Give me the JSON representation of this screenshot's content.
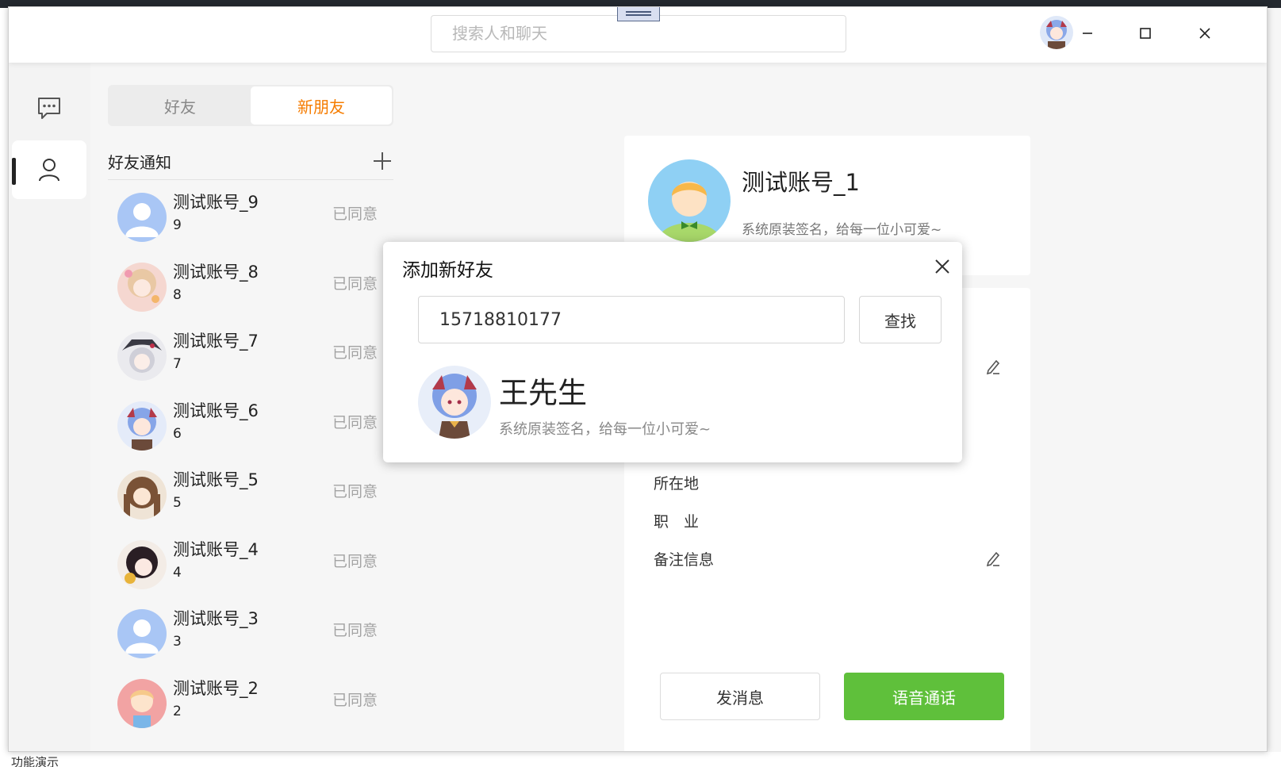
{
  "background": {
    "bottom_text": "功能演示"
  },
  "search": {
    "placeholder": "搜索人和聊天"
  },
  "nav": {
    "items": [
      {
        "name": "chat-icon"
      },
      {
        "name": "contacts-icon"
      }
    ]
  },
  "tabs": [
    {
      "label": "好友",
      "active": false
    },
    {
      "label": "新朋友",
      "active": true
    }
  ],
  "section": {
    "title": "好友通知"
  },
  "friends": [
    {
      "name": "测试账号_9",
      "sub": "9",
      "status": "已同意",
      "avatar": "default"
    },
    {
      "name": "测试账号_8",
      "sub": "8",
      "status": "已同意",
      "avatar": "anime-pink"
    },
    {
      "name": "测试账号_7",
      "sub": "7",
      "status": "已同意",
      "avatar": "anime-hat"
    },
    {
      "name": "测试账号_6",
      "sub": "6",
      "status": "已同意",
      "avatar": "anime-blue"
    },
    {
      "name": "测试账号_5",
      "sub": "5",
      "status": "已同意",
      "avatar": "anime-brown"
    },
    {
      "name": "测试账号_4",
      "sub": "4",
      "status": "已同意",
      "avatar": "anime-dark"
    },
    {
      "name": "测试账号_3",
      "sub": "3",
      "status": "已同意",
      "avatar": "default"
    },
    {
      "name": "测试账号_2",
      "sub": "2",
      "status": "已同意",
      "avatar": "girl"
    }
  ],
  "profile": {
    "name": "测试账号_1",
    "signature": "系统原装签名，给每一位小可爱~",
    "fields": [
      "所在地",
      "职　业",
      "备注信息"
    ],
    "message_button": "发消息",
    "call_button": "语音通话"
  },
  "modal": {
    "title": "添加新好友",
    "input_value": "15718810177",
    "find_button": "查找",
    "result_name": "王先生",
    "result_signature": "系统原装签名，给每一位小可爱~"
  },
  "colors": {
    "accent_orange": "#f57c00",
    "call_green": "#5fc03b",
    "status_gray": "#a3a3a3"
  }
}
